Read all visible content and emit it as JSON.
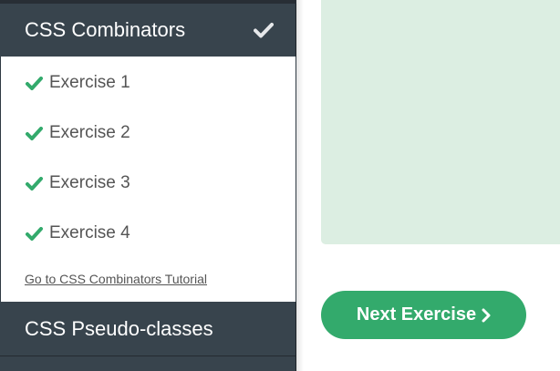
{
  "sidebar": {
    "current_section": {
      "title": "CSS Combinators",
      "completed_icon": "check-icon",
      "exercises": [
        {
          "label": "Exercise 1",
          "status_icon": "check-icon"
        },
        {
          "label": "Exercise 2",
          "status_icon": "check-icon"
        },
        {
          "label": "Exercise 3",
          "status_icon": "check-icon"
        },
        {
          "label": "Exercise 4",
          "status_icon": "check-icon"
        }
      ],
      "tutorial_link": "Go to CSS Combinators Tutorial"
    },
    "next_section": {
      "title": "CSS Pseudo-classes"
    }
  },
  "main": {
    "next_button_label": "Next Exercise",
    "next_button_icon": "chevron-right-icon"
  },
  "colors": {
    "sidebar_header": "#38444d",
    "check_green": "#33aa6c",
    "preview_bg": "#dceee2",
    "button_green": "#33aa6c"
  }
}
